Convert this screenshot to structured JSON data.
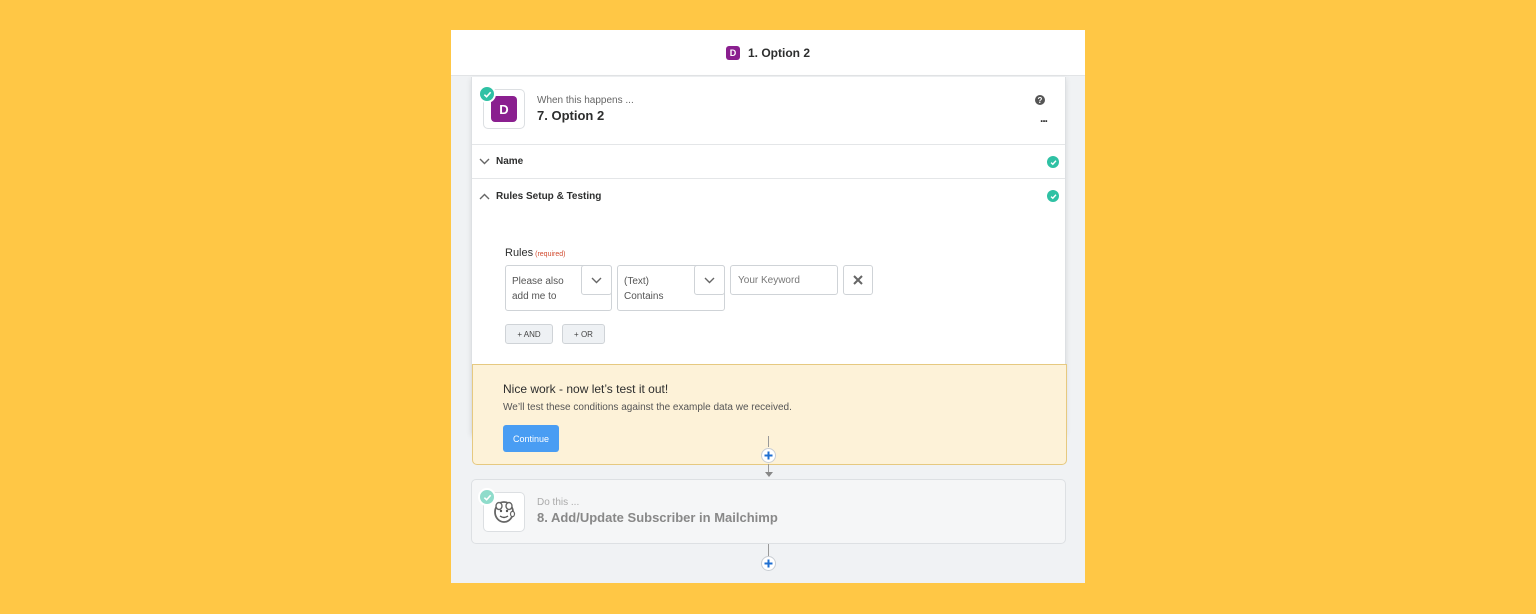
{
  "topbar": {
    "badge_letter": "D",
    "title": "1. Option 2"
  },
  "trigger": {
    "app_letter": "D",
    "subtitle": "When this happens ...",
    "title": "7. Option 2",
    "help_symbol": "?",
    "more_symbol": "..."
  },
  "sections": {
    "name_label": "Name",
    "rules_label": "Rules Setup & Testing"
  },
  "rules": {
    "label": "Rules",
    "required_text": "(required)",
    "field_select": "Please also add me to",
    "operator_select": "(Text) Contains",
    "keyword_placeholder": "Your Keyword",
    "and_button": "+ AND",
    "or_button": "+ OR"
  },
  "notice": {
    "title": "Nice work - now let’s test it out!",
    "body": "We’ll test these conditions against the example data we received.",
    "continue_label": "Continue"
  },
  "action": {
    "subtitle": "Do this ...",
    "title": "8. Add/Update Subscriber in Mailchimp",
    "app_icon": "mailchimp-icon"
  },
  "colors": {
    "background": "#ffc745",
    "app_purple": "#8a1f8f",
    "success_green": "#2fc1a4",
    "primary_blue": "#499df3",
    "notice_bg": "#fdf2d8",
    "plus_blue": "#1f6fd1"
  }
}
